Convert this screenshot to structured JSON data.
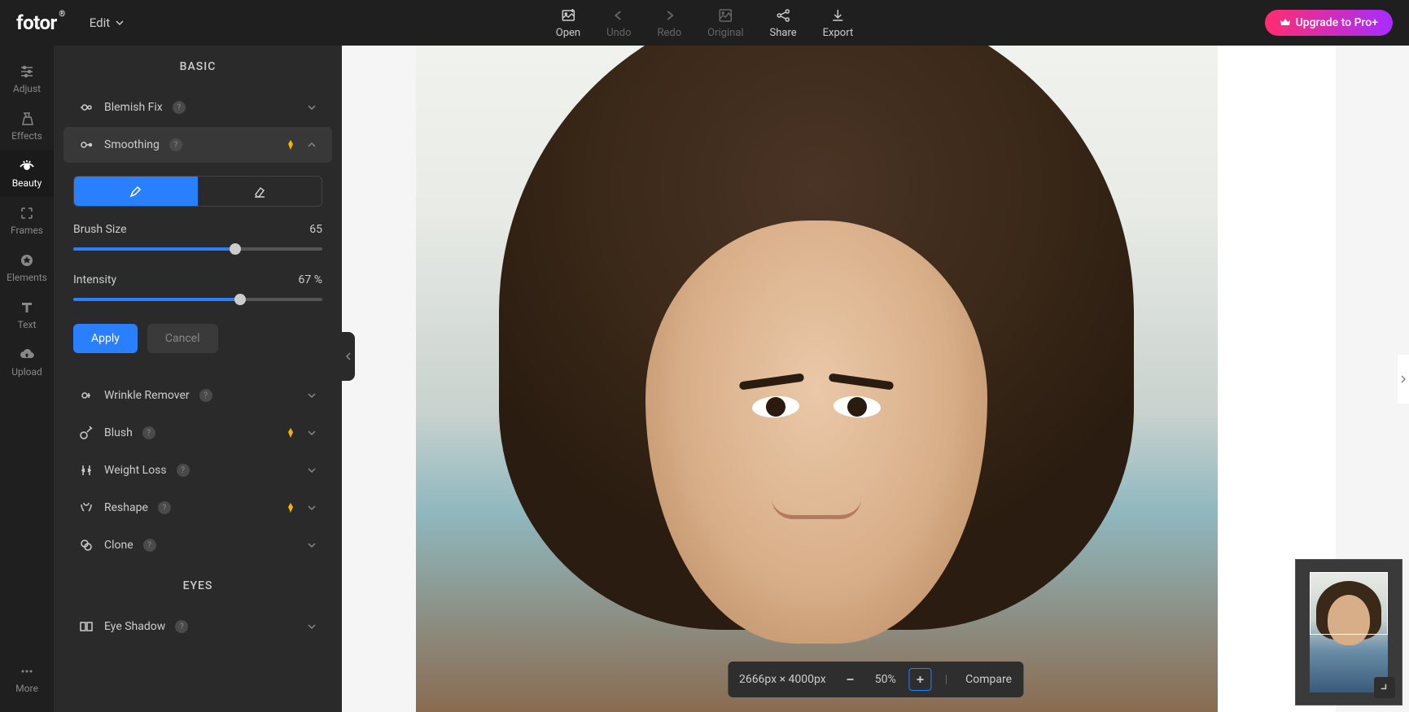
{
  "header": {
    "logo": "fotor",
    "edit_label": "Edit",
    "actions": {
      "open": "Open",
      "undo": "Undo",
      "redo": "Redo",
      "original": "Original",
      "share": "Share",
      "export": "Export"
    },
    "upgrade": "Upgrade to Pro+"
  },
  "nav": {
    "adjust": "Adjust",
    "effects": "Effects",
    "beauty": "Beauty",
    "frames": "Frames",
    "elements": "Elements",
    "text": "Text",
    "upload": "Upload",
    "more": "More"
  },
  "panel": {
    "section_basic": "BASIC",
    "section_eyes": "EYES",
    "tools": {
      "blemish_fix": "Blemish Fix",
      "smoothing": "Smoothing",
      "wrinkle_remover": "Wrinkle Remover",
      "blush": "Blush",
      "weight_loss": "Weight Loss",
      "reshape": "Reshape",
      "clone": "Clone",
      "eye_shadow": "Eye Shadow"
    },
    "smoothing": {
      "brush_size_label": "Brush Size",
      "brush_size_value": "65",
      "intensity_label": "Intensity",
      "intensity_value": "67",
      "intensity_unit": "%",
      "apply": "Apply",
      "cancel": "Cancel"
    }
  },
  "canvas": {
    "dimensions": "2666px × 4000px",
    "zoom": "50%",
    "compare": "Compare"
  }
}
